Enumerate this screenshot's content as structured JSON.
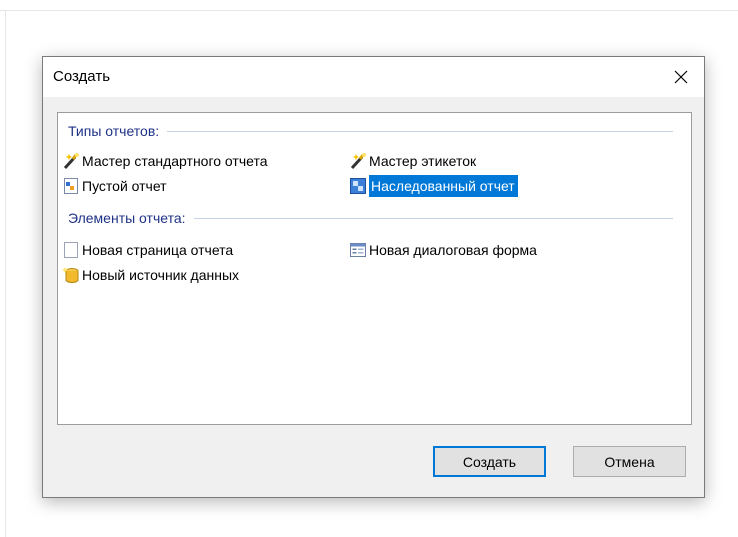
{
  "dialog": {
    "title": "Создать"
  },
  "sections": {
    "report_types": {
      "label": "Типы отчетов:",
      "items": [
        {
          "label": "Мастер стандартного отчета",
          "icon": "magic-wand-icon"
        },
        {
          "label": "Мастер этикеток",
          "icon": "magic-wand-icon"
        },
        {
          "label": "Пустой отчет",
          "icon": "blank-report-icon"
        },
        {
          "label": "Наследованный отчет",
          "icon": "inherited-report-icon",
          "selected": true
        }
      ]
    },
    "report_elements": {
      "label": "Элементы отчета:",
      "items": [
        {
          "label": "Новая страница отчета",
          "icon": "blank-page-icon"
        },
        {
          "label": "Новая диалоговая форма",
          "icon": "dialog-form-icon"
        },
        {
          "label": "Новый источник данных",
          "icon": "new-datasource-icon"
        }
      ]
    }
  },
  "buttons": {
    "create_label": "Создать",
    "cancel_label": "Отмена"
  },
  "colors": {
    "accent": "#0078d7",
    "section_header": "#1e3287"
  }
}
